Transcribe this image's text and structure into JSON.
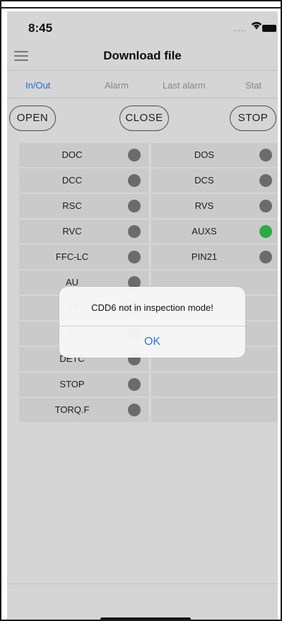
{
  "status": {
    "time": "8:45",
    "signal": "....."
  },
  "header": {
    "title": "Download file"
  },
  "tabs": [
    {
      "label": "In/Out",
      "active": true
    },
    {
      "label": "Alarm",
      "active": false
    },
    {
      "label": "Last alarm",
      "active": false
    },
    {
      "label": "Stat",
      "active": false
    }
  ],
  "actions": {
    "open": "OPEN",
    "close": "CLOSE",
    "stop": "STOP"
  },
  "colors": {
    "accent": "#2a7bdc",
    "indicator_off": "#7a7a7a",
    "indicator_on": "#33c24d"
  },
  "signals": {
    "left": [
      {
        "label": "DOC",
        "state": "off"
      },
      {
        "label": "DCC",
        "state": "off"
      },
      {
        "label": "RSC",
        "state": "off"
      },
      {
        "label": "RVC",
        "state": "off"
      },
      {
        "label": "FFC-LC",
        "state": "off"
      },
      {
        "label": "AU",
        "state": "off"
      },
      {
        "label": "DT",
        "state": "off"
      },
      {
        "label": "E",
        "state": "off"
      },
      {
        "label": "DETC",
        "state": "off"
      },
      {
        "label": "STOP",
        "state": "off"
      },
      {
        "label": "TORQ.F",
        "state": "off"
      }
    ],
    "right": [
      {
        "label": "DOS",
        "state": "off"
      },
      {
        "label": "DCS",
        "state": "off"
      },
      {
        "label": "RVS",
        "state": "off"
      },
      {
        "label": "AUXS",
        "state": "on"
      },
      {
        "label": "PIN21",
        "state": "off"
      }
    ]
  },
  "alert": {
    "message": "CDD6 not in inspection mode!",
    "ok_label": "OK"
  }
}
